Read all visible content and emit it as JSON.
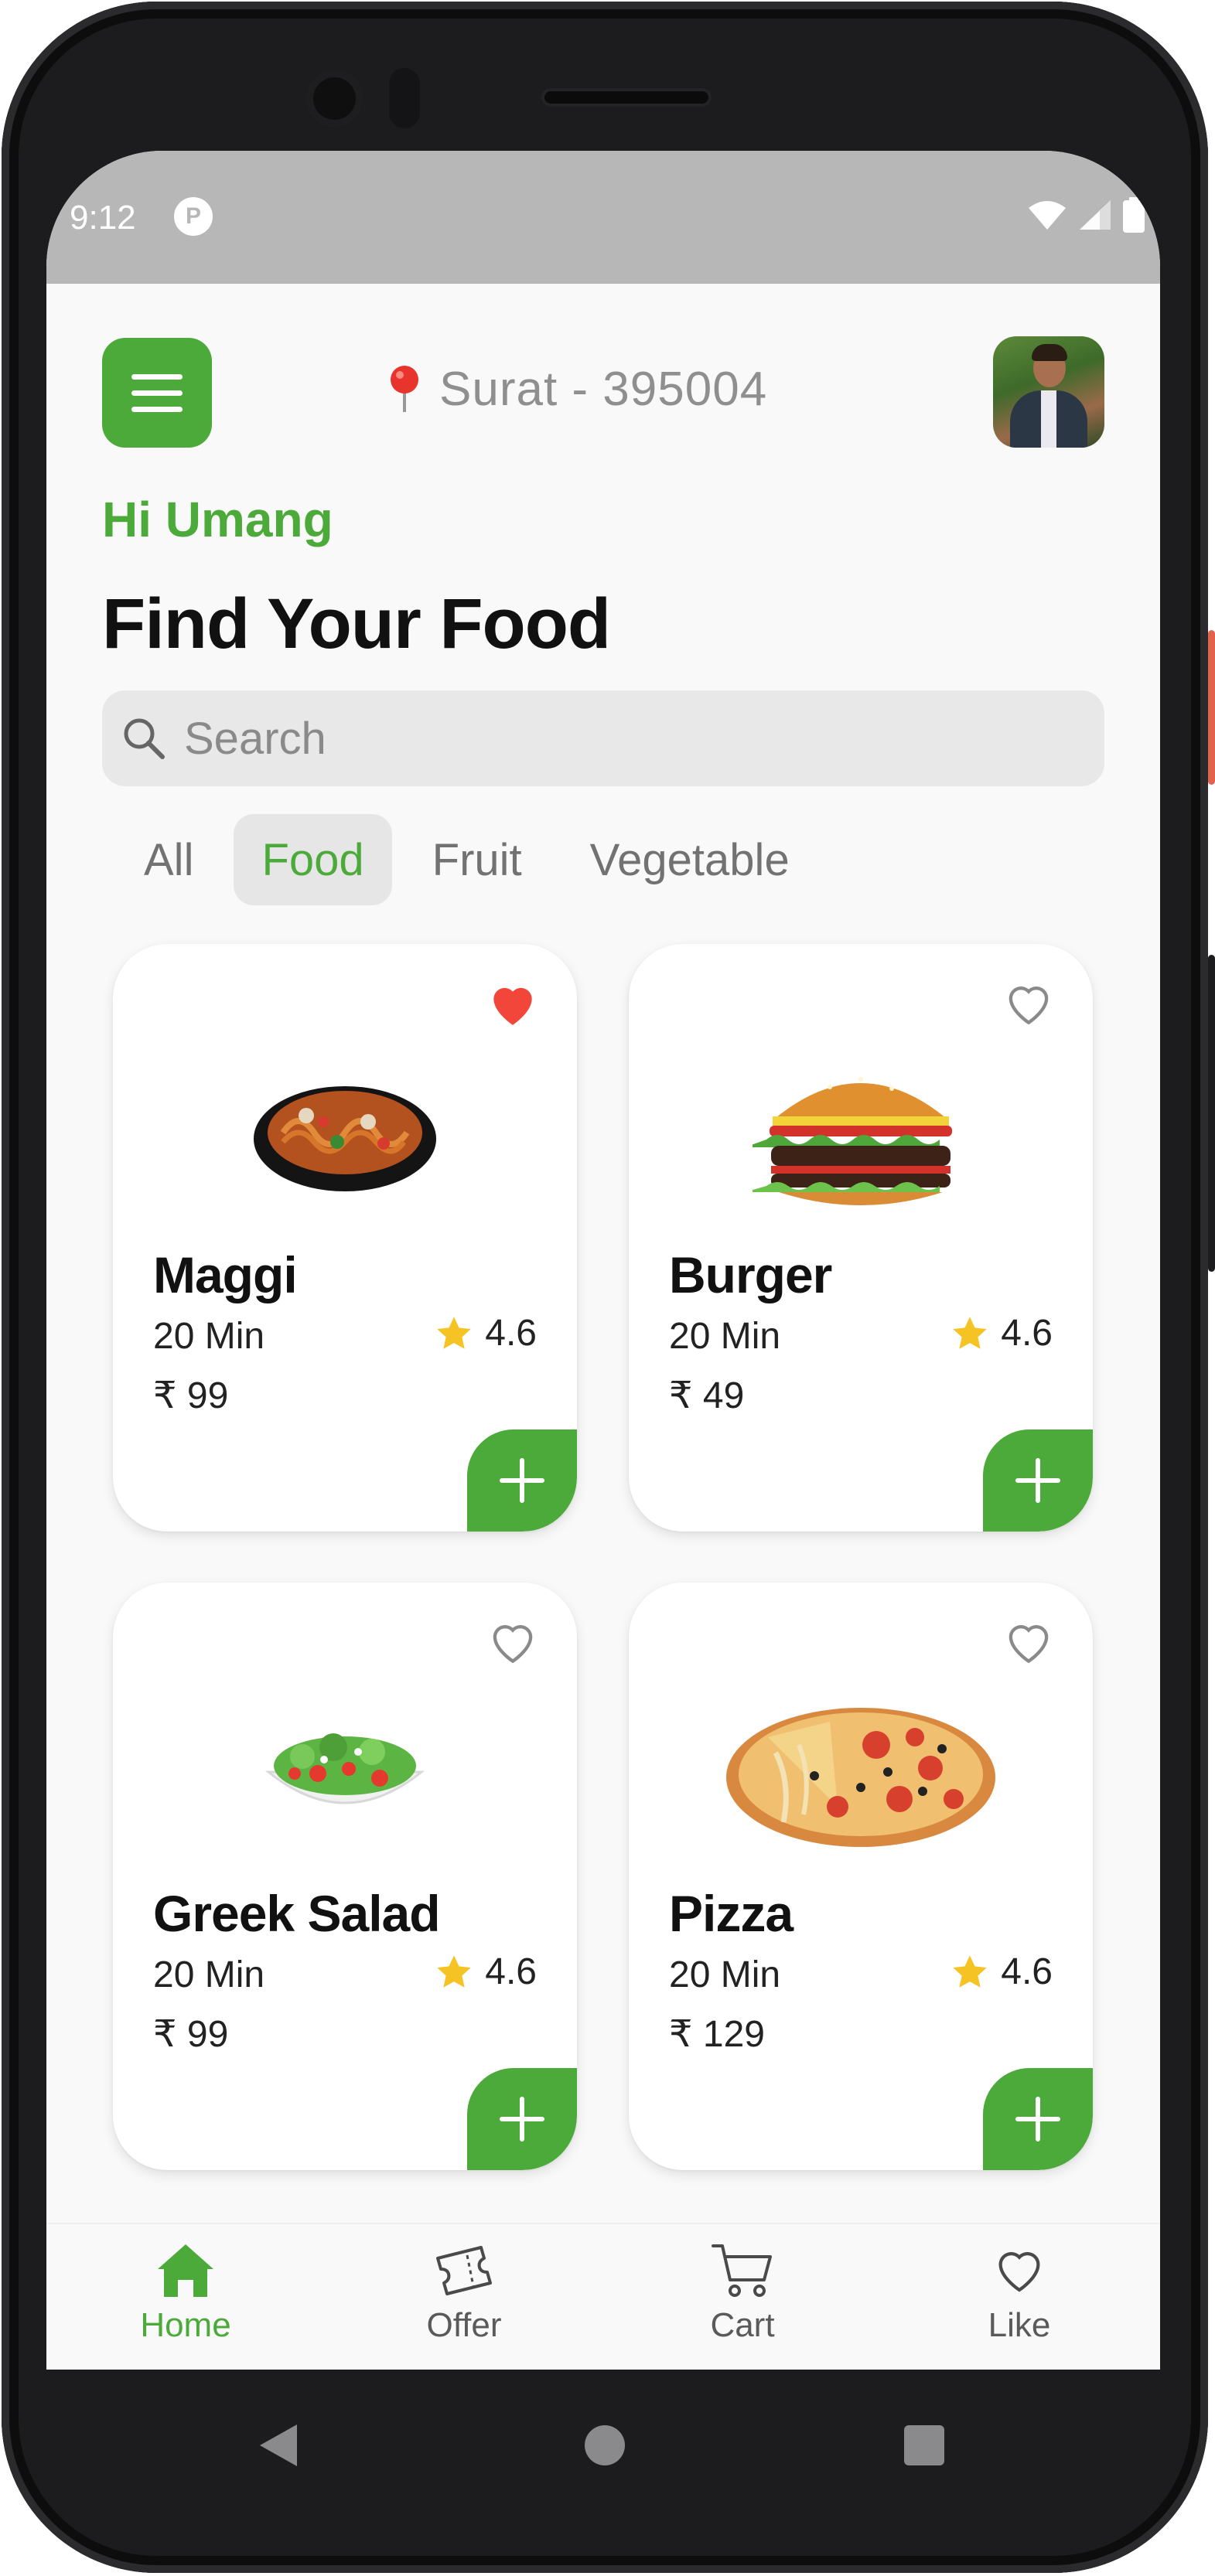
{
  "status": {
    "time": "9:12",
    "app_icon": "pocket-casts-icon",
    "icons": [
      "wifi-icon",
      "signal-icon",
      "battery-icon"
    ]
  },
  "header": {
    "location_icon": "location-pin-icon",
    "location": "Surat - 395004",
    "avatar": "profile-avatar"
  },
  "greeting": "Hi Umang",
  "title": "Find Your Food",
  "search": {
    "placeholder": "Search"
  },
  "tabs": [
    {
      "label": "All",
      "active": false
    },
    {
      "label": "Food",
      "active": true
    },
    {
      "label": "Fruit",
      "active": false
    },
    {
      "label": "Vegetable",
      "active": false
    }
  ],
  "items": [
    {
      "name": "Maggi",
      "time": "20 Min",
      "rating": "4.6",
      "price": "₹ 99",
      "favorite": true,
      "image": "maggi-noodles-image"
    },
    {
      "name": "Burger",
      "time": "20 Min",
      "rating": "4.6",
      "price": "₹ 49",
      "favorite": false,
      "image": "burger-image"
    },
    {
      "name": "Greek Salad",
      "time": "20 Min",
      "rating": "4.6",
      "price": "₹ 99",
      "favorite": false,
      "image": "greek-salad-image"
    },
    {
      "name": "Pizza",
      "time": "20 Min",
      "rating": "4.6",
      "price": "₹ 129",
      "favorite": false,
      "image": "pizza-image"
    }
  ],
  "bottom_nav": [
    {
      "label": "Home",
      "icon": "home-icon",
      "active": true
    },
    {
      "label": "Offer",
      "icon": "ticket-icon",
      "active": false
    },
    {
      "label": "Cart",
      "icon": "cart-icon",
      "active": false
    },
    {
      "label": "Like",
      "icon": "heart-icon",
      "active": false
    }
  ],
  "colors": {
    "accent": "#4caa3a",
    "favorite": "#f2463a",
    "star": "#f6c324",
    "background": "#f9f9f9"
  }
}
